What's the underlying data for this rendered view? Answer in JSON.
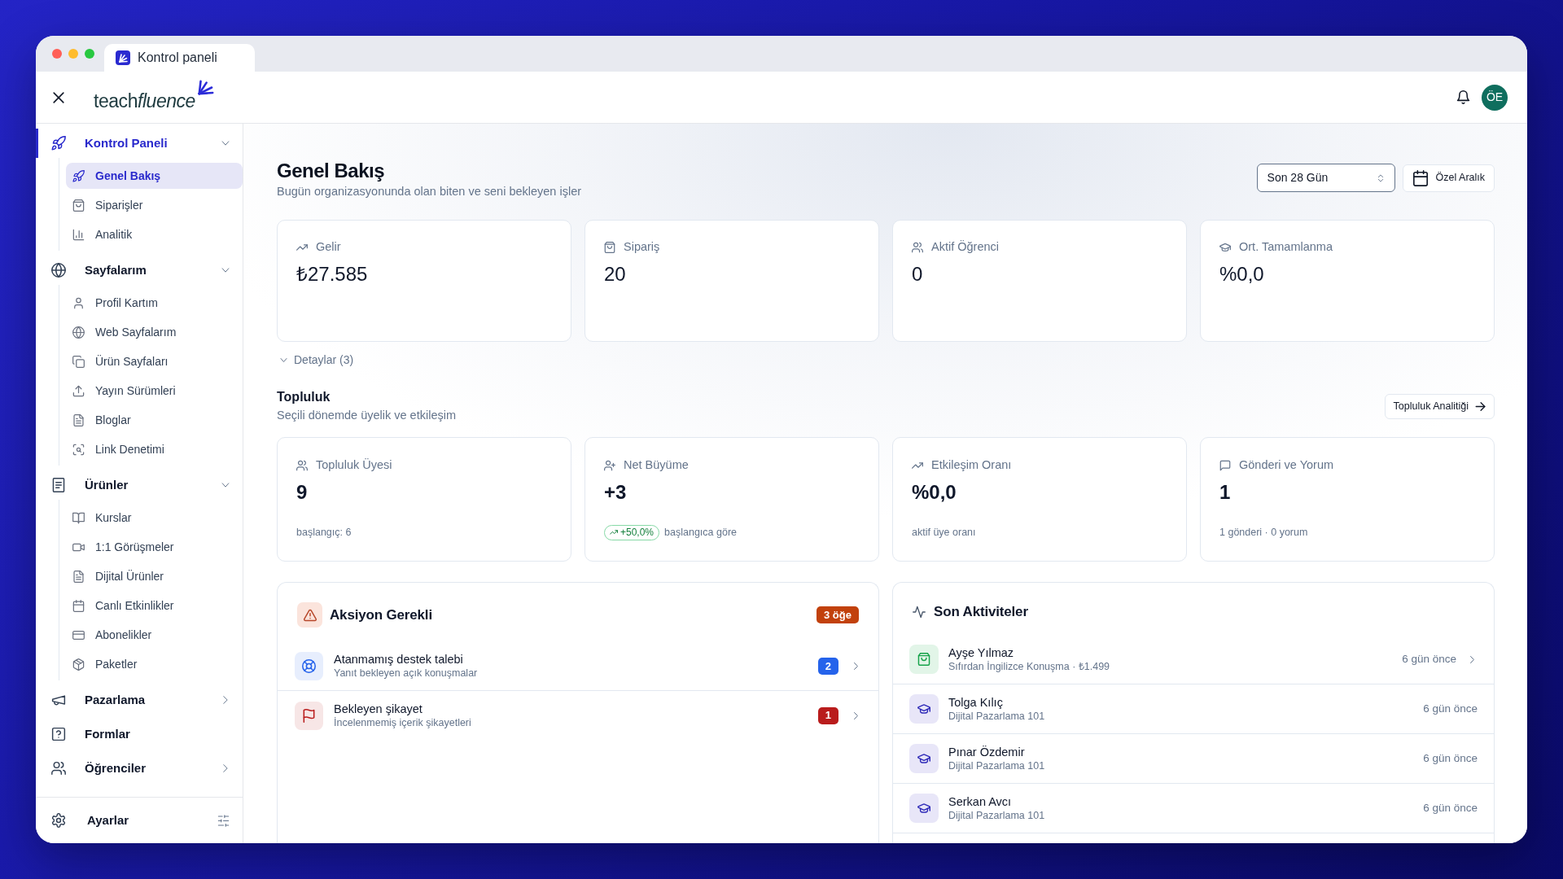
{
  "browser_tab": {
    "title": "Kontrol paneli"
  },
  "header": {
    "logo": {
      "text": "teach",
      "italic_text": "fluence"
    },
    "avatar": "ÖE"
  },
  "sidebar": {
    "groups": [
      {
        "kind": "group",
        "label": "Kontrol Paneli",
        "selected": true,
        "expanded": true,
        "children": [
          {
            "label": "Genel Bakış",
            "selected": true
          },
          {
            "label": "Siparişler",
            "selected": false
          },
          {
            "label": "Analitik",
            "selected": false
          }
        ]
      },
      {
        "kind": "group",
        "label": "Sayfalarım",
        "selected": false,
        "expanded": true,
        "children": [
          {
            "label": "Profil Kartım",
            "selected": false
          },
          {
            "label": "Web Sayfalarım",
            "selected": false
          },
          {
            "label": "Ürün Sayfaları",
            "selected": false
          },
          {
            "label": "Yayın Sürümleri",
            "selected": false
          },
          {
            "label": "Bloglar",
            "selected": false
          },
          {
            "label": "Link Denetimi",
            "selected": false
          }
        ]
      },
      {
        "kind": "group",
        "label": "Ürünler",
        "selected": false,
        "expanded": true,
        "children": [
          {
            "label": "Kurslar",
            "selected": false
          },
          {
            "label": "1:1 Görüşmeler",
            "selected": false
          },
          {
            "label": "Dijital Ürünler",
            "selected": false
          },
          {
            "label": "Canlı Etkinlikler",
            "selected": false
          },
          {
            "label": "Abonelikler",
            "selected": false
          },
          {
            "label": "Paketler",
            "selected": false
          }
        ]
      },
      {
        "kind": "group",
        "label": "Pazarlama",
        "selected": false,
        "expanded": false
      },
      {
        "kind": "link",
        "label": "Formlar",
        "selected": false
      },
      {
        "kind": "group",
        "label": "Öğrenciler",
        "selected": false,
        "expanded": false
      }
    ],
    "footer": {
      "label": "Ayarlar"
    }
  },
  "page": {
    "title": "Genel Bakış",
    "subtitle": "Bugün organizasyonunda olan biten ve seni bekleyen işler",
    "period_select": {
      "value": "Son 28 Gün"
    },
    "custom_range_button": "Özel Aralık"
  },
  "stats": [
    {
      "label": "Gelir",
      "value": "₺27.585"
    },
    {
      "label": "Sipariş",
      "value": "20"
    },
    {
      "label": "Aktif Öğrenci",
      "value": "0"
    },
    {
      "label": "Ort. Tamamlanma",
      "value": "%0,0"
    }
  ],
  "details_toggle": {
    "label": "Detaylar (3)",
    "expanded": false
  },
  "community": {
    "title": "Topluluk",
    "subtitle": "Seçili dönemde üyelik ve etkileşim",
    "button": "Topluluk Analitiği",
    "cards": [
      {
        "label": "Topluluk Üyesi",
        "value": "9",
        "note": "başlangıç: 6"
      },
      {
        "label": "Net Büyüme",
        "value": "+3",
        "badge": "+50,0%",
        "note": "başlangıca göre"
      },
      {
        "label": "Etkileşim Oranı",
        "value": "%0,0",
        "note": "aktif üye oranı"
      },
      {
        "label": "Gönderi ve Yorum",
        "value": "1",
        "note": "1 gönderi · 0 yorum"
      }
    ]
  },
  "action_panel": {
    "title": "Aksiyon Gerekli",
    "badge": "3 öğe",
    "items": [
      {
        "title": "Atanmamış destek talebi",
        "subtitle": "Yanıt bekleyen açık konuşmalar",
        "count": "2",
        "color": "#2563eb"
      },
      {
        "title": "Bekleyen şikayet",
        "subtitle": "İncelenmemiş içerik şikayetleri",
        "count": "1",
        "color": "#b91c1c"
      }
    ]
  },
  "activity_panel": {
    "title": "Son Aktiviteler",
    "items": [
      {
        "kind": "order",
        "name": "Ayşe Yılmaz",
        "detail": "Sıfırdan İngilizce Konuşma · ₺1.499",
        "time": "6 gün önce"
      },
      {
        "kind": "enrollment",
        "name": "Tolga Kılıç",
        "detail": "Dijital Pazarlama 101",
        "time": "6 gün önce"
      },
      {
        "kind": "enrollment",
        "name": "Pınar Özdemir",
        "detail": "Dijital Pazarlama 101",
        "time": "6 gün önce"
      },
      {
        "kind": "enrollment",
        "name": "Serkan Avcı",
        "detail": "Dijital Pazarlama 101",
        "time": "6 gün önce"
      }
    ]
  }
}
